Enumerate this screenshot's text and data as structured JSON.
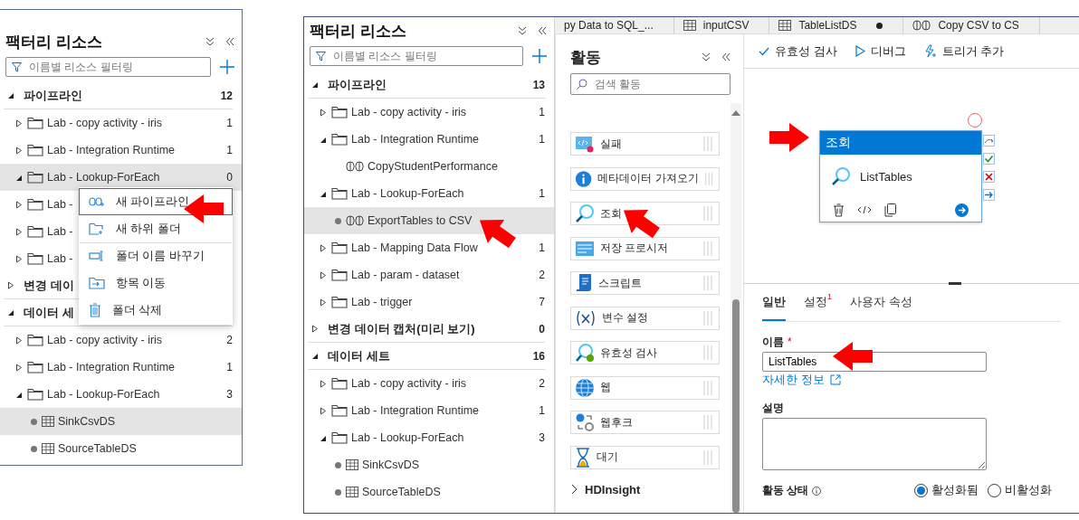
{
  "left_shot": {
    "factory": {
      "title": "팩터리 리소스",
      "filter_placeholder": "이름별 리소스 필터링",
      "sections": [
        {
          "label": "파이프라인",
          "count": "12",
          "expanded": true,
          "children": [
            {
              "kind": "folder",
              "label": "Lab - copy activity - iris",
              "count": "1",
              "expanded": false,
              "selected": false
            },
            {
              "kind": "folder",
              "label": "Lab - Integration Runtime",
              "count": "1",
              "expanded": false,
              "selected": false
            },
            {
              "kind": "folder",
              "label": "Lab - Lookup-ForEach",
              "count": "0",
              "expanded": true,
              "selected": true
            },
            {
              "kind": "folder",
              "label": "Lab -",
              "expanded": false,
              "selected": false
            },
            {
              "kind": "folder",
              "label": "Lab -",
              "expanded": false,
              "selected": false
            },
            {
              "kind": "folder",
              "label": "Lab -",
              "expanded": false,
              "selected": false
            }
          ]
        },
        {
          "label": "변경 데이",
          "expanded": false
        },
        {
          "label": "데이터 세",
          "expanded": true,
          "children": [
            {
              "kind": "folder",
              "label": "Lab - copy activity - iris",
              "count": "2",
              "expanded": false,
              "selected": false
            },
            {
              "kind": "folder",
              "label": "Lab - Integration Runtime",
              "count": "1",
              "expanded": false,
              "selected": false
            },
            {
              "kind": "folder",
              "label": "Lab - Lookup-ForEach",
              "count": "3",
              "expanded": true,
              "selected": false,
              "children": [
                {
                  "kind": "dataset",
                  "label": "SinkCsvDS",
                  "modified": true,
                  "selected": true
                },
                {
                  "kind": "dataset",
                  "label": "SourceTableDS",
                  "modified": true,
                  "selected": false
                }
              ]
            }
          ]
        }
      ]
    },
    "context_menu": [
      {
        "label": "새 파이프라인",
        "selected": true,
        "separator": false
      },
      {
        "label": "새 하위 폴더",
        "selected": false,
        "separator": false
      },
      {
        "label": "폴더 이름 바꾸기",
        "selected": false,
        "separator": true
      },
      {
        "label": "항목 이동",
        "selected": false,
        "separator": false
      },
      {
        "label": "폴더 삭제",
        "selected": false,
        "separator": false
      }
    ]
  },
  "right_shot": {
    "factory": {
      "title": "팩터리 리소스",
      "filter_placeholder": "이름별 리소스 필터링",
      "sections": [
        {
          "label": "파이프라인",
          "count": "13",
          "expanded": true,
          "children": [
            {
              "kind": "folder",
              "label": "Lab - copy activity - iris",
              "count": "1",
              "expanded": false,
              "selected": false
            },
            {
              "kind": "folder",
              "label": "Lab - Integration Runtime",
              "count": "1",
              "expanded": true,
              "selected": false,
              "children": [
                {
                  "kind": "pipeline",
                  "label": "CopyStudentPerformance",
                  "modified": false,
                  "selected": false
                }
              ]
            },
            {
              "kind": "folder",
              "label": "Lab - Lookup-ForEach",
              "count": "1",
              "expanded": true,
              "selected": false,
              "children": [
                {
                  "kind": "pipeline",
                  "label": "ExportTables to CSV",
                  "modified": true,
                  "selected": true
                }
              ]
            },
            {
              "kind": "folder",
              "label": "Lab - Mapping Data Flow",
              "count": "1",
              "expanded": false,
              "selected": false
            },
            {
              "kind": "folder",
              "label": "Lab - param - dataset",
              "count": "2",
              "expanded": false,
              "selected": false
            },
            {
              "kind": "folder",
              "label": "Lab - trigger",
              "count": "7",
              "expanded": false,
              "selected": false
            }
          ]
        },
        {
          "label": "변경 데이터 캡처(미리 보기)",
          "count": "0",
          "expanded": false
        },
        {
          "label": "데이터 세트",
          "count": "16",
          "expanded": true,
          "children": [
            {
              "kind": "folder",
              "label": "Lab - copy activity - iris",
              "count": "2",
              "expanded": false,
              "selected": false
            },
            {
              "kind": "folder",
              "label": "Lab - Integration Runtime",
              "count": "1",
              "expanded": false,
              "selected": false
            },
            {
              "kind": "folder",
              "label": "Lab - Lookup-ForEach",
              "count": "3",
              "expanded": true,
              "selected": false,
              "children": [
                {
                  "kind": "dataset",
                  "label": "SinkCsvDS",
                  "modified": true,
                  "selected": false
                },
                {
                  "kind": "dataset",
                  "label": "SourceTableDS",
                  "modified": true,
                  "selected": false
                }
              ]
            }
          ]
        }
      ]
    },
    "tabs": [
      {
        "label": "py Data to SQL_...",
        "kind": "plain",
        "modified": false
      },
      {
        "label": "inputCSV",
        "kind": "dataset",
        "modified": false
      },
      {
        "label": "TableListDS",
        "kind": "dataset",
        "modified": true
      },
      {
        "label": "Copy CSV to CS",
        "kind": "pipeline",
        "modified": false
      }
    ],
    "activities": {
      "title": "활동",
      "search_placeholder": "검색 활동",
      "items": [
        "실패",
        "메타데이터 가져오기",
        "조회",
        "저장 프로시저",
        "스크립트",
        "변수 설정",
        "유효성 검사",
        "웹",
        "웹후크",
        "대기"
      ],
      "groups": [
        {
          "label": "HDInsight",
          "expanded": false
        }
      ]
    },
    "toolbar": [
      "유효성 검사",
      "디버그",
      "트리거 추가"
    ],
    "node": {
      "type_label": "조회",
      "name": "ListTables"
    },
    "properties": {
      "tabs": [
        {
          "label": "일반",
          "selected": true
        },
        {
          "label": "설정",
          "badge": "1",
          "selected": false
        },
        {
          "label": "사용자 속성",
          "selected": false
        }
      ],
      "name_label": "이름",
      "required_mark": "*",
      "name_value": "ListTables",
      "more_info_link": "자세한 정보",
      "description_label": "설명",
      "state_label": "활동 상태",
      "state_options": [
        {
          "label": "활성화됨",
          "selected": true
        },
        {
          "label": "비활성화",
          "selected": false
        }
      ]
    }
  }
}
